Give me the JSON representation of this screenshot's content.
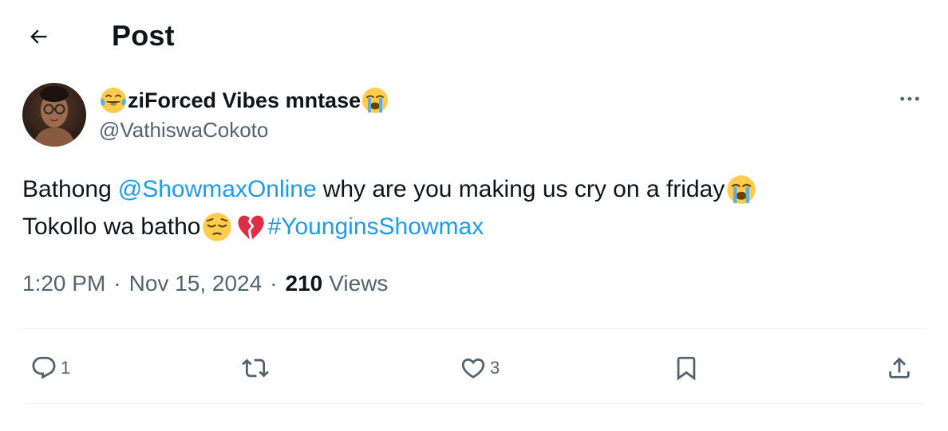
{
  "header": {
    "title": "Post",
    "back_icon": "arrow-left-icon"
  },
  "author": {
    "display_name": "ziForced Vibes mntase",
    "display_name_prefix_emoji": "face-with-tears-of-joy",
    "display_name_suffix_emoji": "loudly-crying-face",
    "handle": "@VathiswaCokoto"
  },
  "post": {
    "line1": {
      "text_before": "Bathong",
      "mention": "@ShowmaxOnline",
      "text_after": "why are you making us cry on a friday",
      "trailing_emoji": "loudly-crying-face"
    },
    "line2": {
      "text": "Tokollo wa batho",
      "emojis": [
        "pensive-face",
        "broken-heart"
      ],
      "hashtag": "#YounginsShowmax"
    }
  },
  "meta": {
    "time": "1:20 PM",
    "separator": "·",
    "date": "Nov 15, 2024",
    "views_count": "210",
    "views_label": "Views"
  },
  "actions": {
    "reply_count": "1",
    "repost_count": "",
    "like_count": "3"
  },
  "colors": {
    "text": "#0f1419",
    "secondary": "#536471",
    "link": "#1d9bf0",
    "divider": "#eff3f4"
  }
}
